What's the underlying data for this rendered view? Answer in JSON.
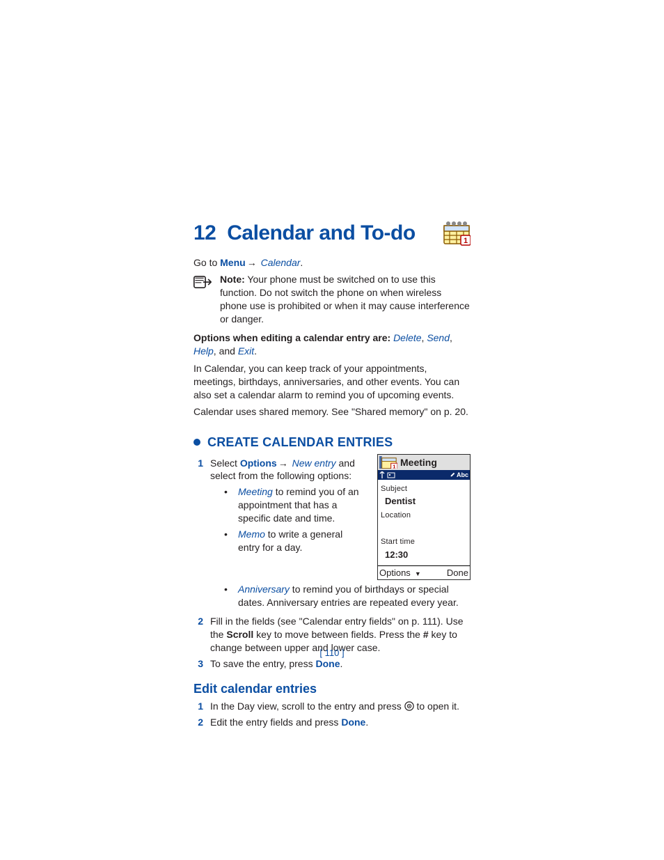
{
  "chapter": {
    "number": "12",
    "title": "Calendar and To-do"
  },
  "goto": {
    "prefix": "Go to ",
    "menu": "Menu",
    "arrow": "→",
    "calendar": "Calendar",
    "dot": "."
  },
  "note": {
    "label": "Note:",
    "text": " Your phone must be switched on to use this function. Do not switch the phone on when wireless phone use is prohibited or when it may cause interference or danger."
  },
  "options_line": {
    "lead": "Options when editing a calendar entry are: ",
    "delete": "Delete",
    "c1": ", ",
    "send": "Send",
    "c2": ", ",
    "help": "Help",
    "c3": ", and ",
    "exit": "Exit",
    "dot": "."
  },
  "intro": "In Calendar, you can keep track of your appointments, meetings, birthdays, anniversaries, and other events. You can also set a calendar alarm to remind you of upcoming events.",
  "shared_mem": "Calendar uses shared memory. See \"Shared memory\" on p. 20.",
  "section_create": {
    "title": "CREATE CALENDAR ENTRIES"
  },
  "step1": {
    "num": "1",
    "pre": "Select ",
    "options": "Options",
    "arrow": "→",
    "newentry": "New entry",
    "post": " and select from the following options:"
  },
  "entry_types": {
    "meeting": {
      "name": "Meeting",
      "desc": " to remind you of an appointment that has a specific date and time."
    },
    "memo": {
      "name": "Memo",
      "desc": " to write a general entry for a day."
    },
    "anniversary": {
      "name": "Anniversary",
      "desc": " to remind you of birthdays or special dates. Anniversary entries are repeated every year."
    }
  },
  "step2": {
    "num": "2",
    "t1": "Fill in the fields (see \"Calendar entry fields\" on p. 111). Use the ",
    "scroll": "Scroll",
    "t2": " key to move between fields. Press the ",
    "hash": "#",
    "t3": " key to change between upper and lower case."
  },
  "step3": {
    "num": "3",
    "pre": "To save the entry, press ",
    "done": "Done",
    "dot": "."
  },
  "section_edit": {
    "title": "Edit calendar entries"
  },
  "edit1": {
    "num": "1",
    "pre": "In the Day view, scroll to the entry and press ",
    "post": " to open it."
  },
  "edit2": {
    "num": "2",
    "pre": "Edit the entry fields and press ",
    "done": "Done",
    "dot": "."
  },
  "phone": {
    "title": "Meeting",
    "status_right": "Abc",
    "subject_label": "Subject",
    "subject_value": "Dentist",
    "location_label": "Location",
    "start_label": "Start time",
    "start_value": "12:30",
    "sk_left": "Options",
    "sk_right": "Done"
  },
  "page_footer": "[ 110 ]"
}
